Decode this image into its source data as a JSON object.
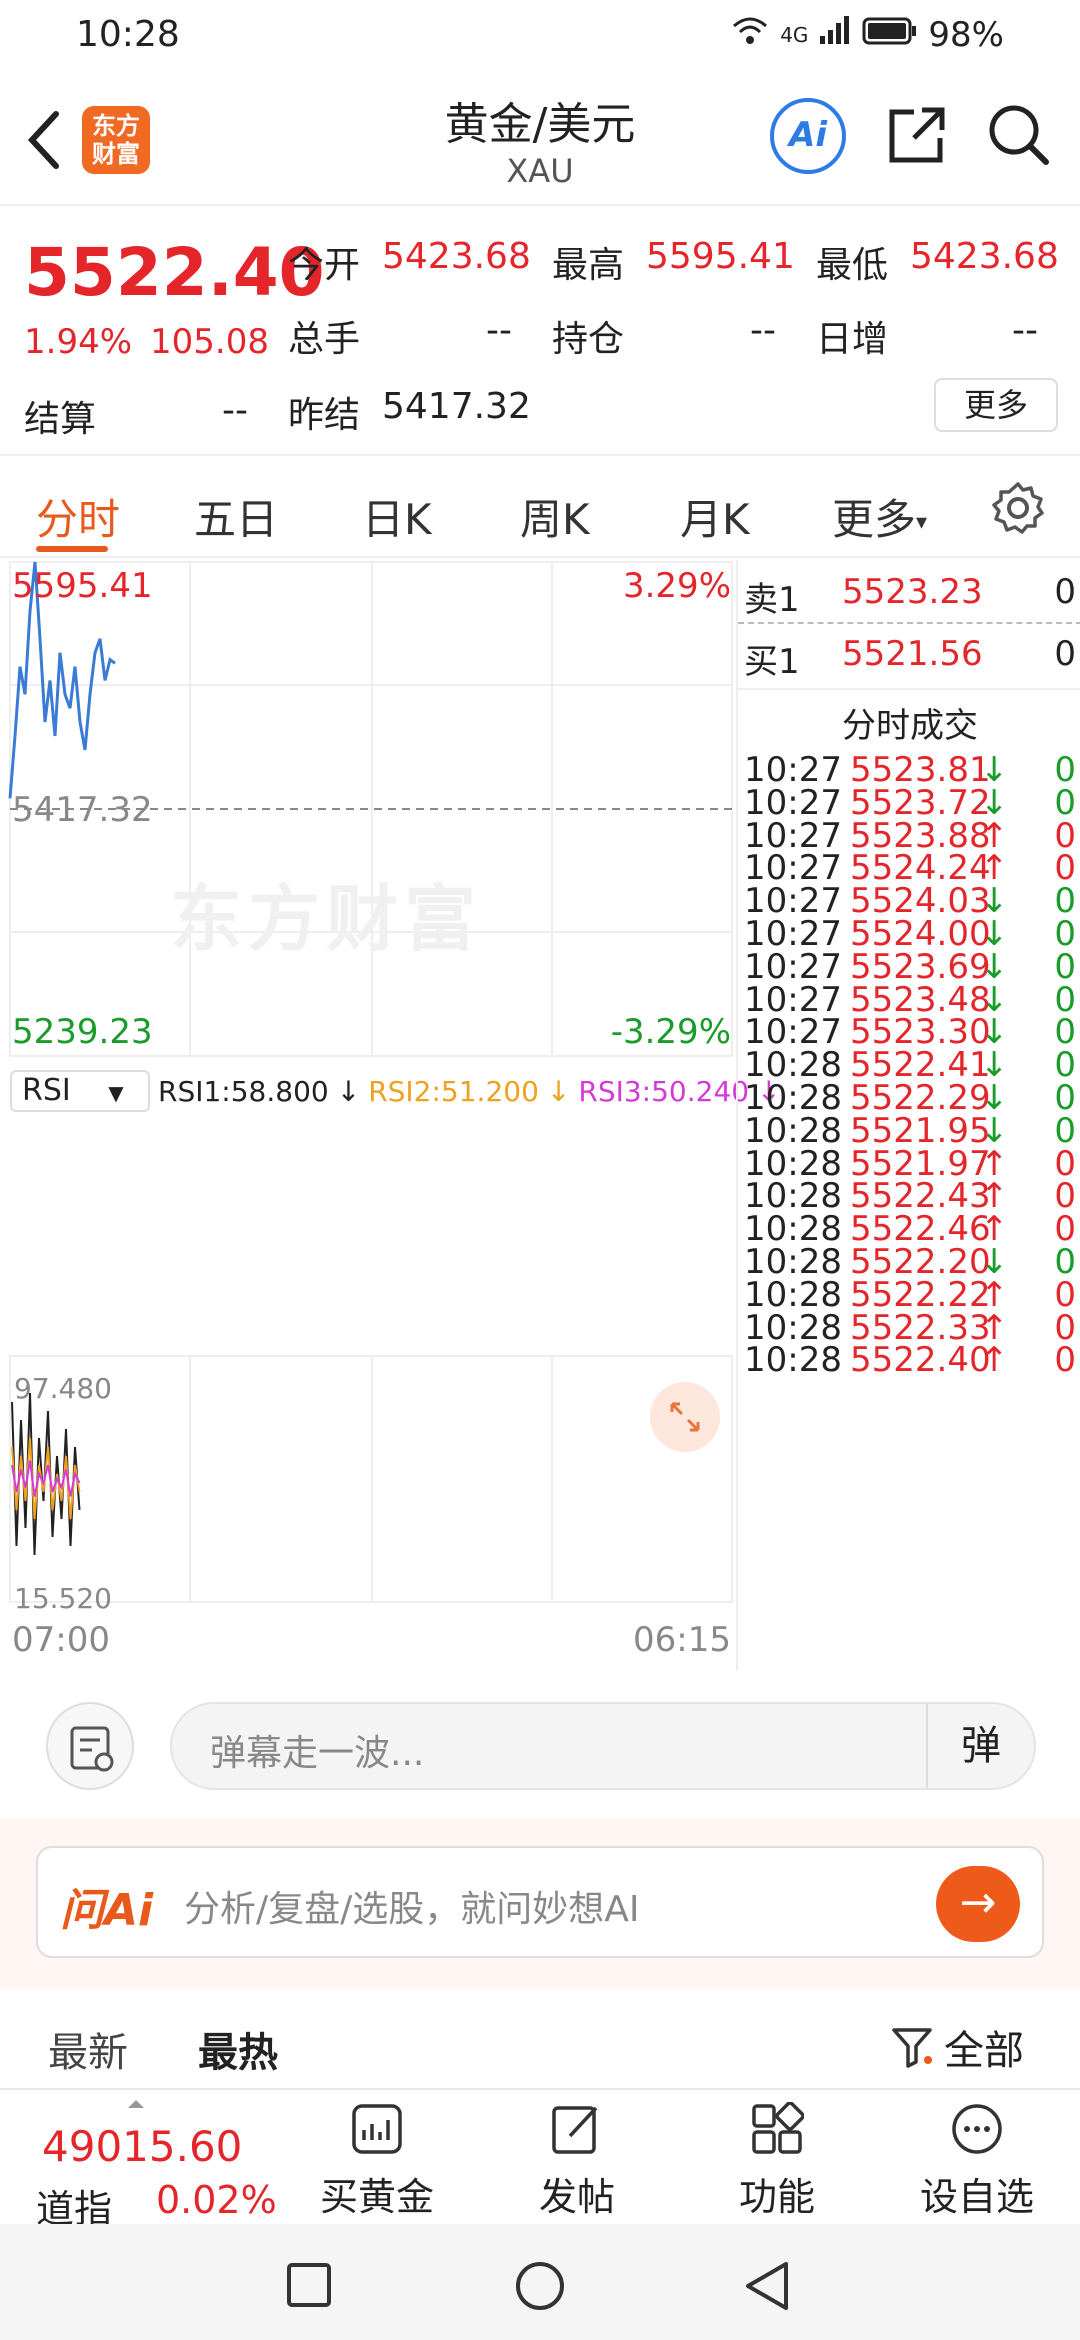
{
  "status_bar": {
    "time": "10:28",
    "network": "4G",
    "battery": "98%"
  },
  "header": {
    "logo_text_1": "东方",
    "logo_text_2": "财富",
    "title": "黄金/美元",
    "subtitle": "XAU",
    "ai_label": "Ai"
  },
  "quote": {
    "price": "5522.40",
    "change_pct": "1.94%",
    "change": "105.08",
    "open_label": "今开",
    "open": "5423.68",
    "high_label": "最高",
    "high": "5595.41",
    "low_label": "最低",
    "low": "5423.68",
    "volume_label": "总手",
    "volume": "--",
    "position_label": "持仓",
    "position": "--",
    "daily_inc_label": "日增",
    "daily_inc": "--",
    "settle_label": "结算",
    "settle": "--",
    "prev_settle_label": "昨结",
    "prev_settle": "5417.32",
    "more_label": "更多"
  },
  "tabs": [
    "分时",
    "五日",
    "日K",
    "周K",
    "月K",
    "更多"
  ],
  "chart": {
    "max_price": "5595.41",
    "max_pct": "3.29%",
    "prev_close": "5417.32",
    "min_price": "5239.23",
    "min_pct": "-3.29%",
    "watermark": "东方财富",
    "indicator": "RSI",
    "rsi1": "RSI1:58.800",
    "rsi2": "RSI2:51.200",
    "rsi3": "RSI3:50.240",
    "rsi_top": "97.480",
    "rsi_bottom": "15.520",
    "time_start": "07:00",
    "time_end": "06:15",
    "colors": {
      "price_line": "#3a7bd5",
      "rsi1": "#222222",
      "rsi2": "#f0a020",
      "rsi3": "#d63ad6"
    }
  },
  "chart_data": {
    "type": "line",
    "title": "",
    "xlabel": "",
    "ylabel": "",
    "ylim": [
      5239.23,
      5595.41
    ],
    "x_range": [
      "07:00",
      "06:15"
    ],
    "reference_line": 5417.32,
    "series": [
      {
        "values": [
          5425,
          5470,
          5520,
          5500,
          5560,
          5595.41,
          5540,
          5480,
          5510,
          5470,
          5530,
          5500,
          5490,
          5520,
          5480,
          5460,
          5500,
          5530,
          5540,
          5510,
          5525,
          5522.4
        ]
      }
    ]
  },
  "book": {
    "sell1_label": "卖1",
    "sell1_price": "5523.23",
    "sell1_vol": "0",
    "buy1_label": "买1",
    "buy1_price": "5521.56",
    "buy1_vol": "0",
    "trades_title": "分时成交",
    "trades": [
      {
        "t": "10:27",
        "p": "5523.81",
        "dir": "↓",
        "v": "0"
      },
      {
        "t": "10:27",
        "p": "5523.72",
        "dir": "↓",
        "v": "0"
      },
      {
        "t": "10:27",
        "p": "5523.88",
        "dir": "↑",
        "v": "0"
      },
      {
        "t": "10:27",
        "p": "5524.24",
        "dir": "↑",
        "v": "0"
      },
      {
        "t": "10:27",
        "p": "5524.03",
        "dir": "↓",
        "v": "0"
      },
      {
        "t": "10:27",
        "p": "5524.00",
        "dir": "↓",
        "v": "0"
      },
      {
        "t": "10:27",
        "p": "5523.69",
        "dir": "↓",
        "v": "0"
      },
      {
        "t": "10:27",
        "p": "5523.48",
        "dir": "↓",
        "v": "0"
      },
      {
        "t": "10:27",
        "p": "5523.30",
        "dir": "↓",
        "v": "0"
      },
      {
        "t": "10:28",
        "p": "5522.41",
        "dir": "↓",
        "v": "0"
      },
      {
        "t": "10:28",
        "p": "5522.29",
        "dir": "↓",
        "v": "0"
      },
      {
        "t": "10:28",
        "p": "5521.95",
        "dir": "↓",
        "v": "0"
      },
      {
        "t": "10:28",
        "p": "5521.97",
        "dir": "↑",
        "v": "0"
      },
      {
        "t": "10:28",
        "p": "5522.43",
        "dir": "↑",
        "v": "0"
      },
      {
        "t": "10:28",
        "p": "5522.46",
        "dir": "↑",
        "v": "0"
      },
      {
        "t": "10:28",
        "p": "5522.20",
        "dir": "↓",
        "v": "0"
      },
      {
        "t": "10:28",
        "p": "5522.22",
        "dir": "↑",
        "v": "0"
      },
      {
        "t": "10:28",
        "p": "5522.33",
        "dir": "↑",
        "v": "0"
      },
      {
        "t": "10:28",
        "p": "5522.40",
        "dir": "↑",
        "v": "0"
      }
    ]
  },
  "comment": {
    "placeholder": "弹幕走一波...",
    "dan_label": "弹"
  },
  "ai_ask": {
    "label": "问Ai",
    "placeholder": "分析/复盘/选股，就问妙想AI",
    "go": "→"
  },
  "filter": {
    "latest": "最新",
    "hottest": "最热",
    "all": "全部"
  },
  "bottom_bar": {
    "index_value": "49015.60",
    "index_name": "道指",
    "index_change": "0.02%",
    "items": [
      "买黄金",
      "发帖",
      "功能",
      "设自选"
    ]
  }
}
